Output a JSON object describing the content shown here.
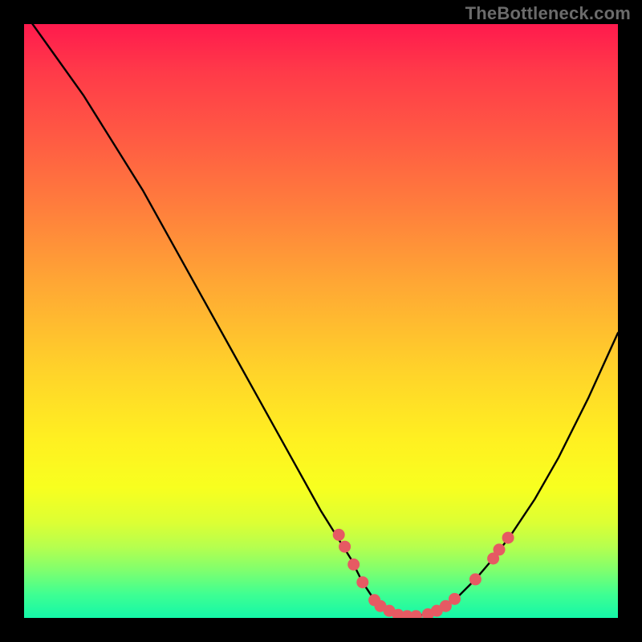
{
  "watermark": "TheBottleneck.com",
  "chart_data": {
    "type": "line",
    "title": "",
    "xlabel": "",
    "ylabel": "",
    "xlim": [
      0,
      100
    ],
    "ylim": [
      0,
      100
    ],
    "grid": false,
    "legend": false,
    "series": [
      {
        "name": "bottleneck-curve",
        "x": [
          0,
          5,
          10,
          15,
          20,
          25,
          30,
          35,
          40,
          45,
          50,
          55,
          57,
          59,
          61,
          63,
          65,
          67,
          70,
          73,
          76,
          79,
          82,
          86,
          90,
          95,
          100
        ],
        "y": [
          102,
          95,
          88,
          80,
          72,
          63,
          54,
          45,
          36,
          27,
          18,
          10,
          6,
          3,
          1,
          0.3,
          0.2,
          0.5,
          1.5,
          3.5,
          6.5,
          10,
          14,
          20,
          27,
          37,
          48
        ],
        "color": "#000000"
      }
    ],
    "markers": {
      "name": "highlight-dots",
      "color": "#e65a63",
      "points": [
        {
          "x": 53,
          "y": 14
        },
        {
          "x": 54,
          "y": 12
        },
        {
          "x": 55.5,
          "y": 9
        },
        {
          "x": 57,
          "y": 6
        },
        {
          "x": 59,
          "y": 3
        },
        {
          "x": 60,
          "y": 2
        },
        {
          "x": 61.5,
          "y": 1.2
        },
        {
          "x": 63,
          "y": 0.5
        },
        {
          "x": 64.5,
          "y": 0.3
        },
        {
          "x": 66,
          "y": 0.3
        },
        {
          "x": 68,
          "y": 0.6
        },
        {
          "x": 69.5,
          "y": 1.2
        },
        {
          "x": 71,
          "y": 2
        },
        {
          "x": 72.5,
          "y": 3.2
        },
        {
          "x": 76,
          "y": 6.5
        },
        {
          "x": 79,
          "y": 10
        },
        {
          "x": 80,
          "y": 11.5
        },
        {
          "x": 81.5,
          "y": 13.5
        }
      ]
    }
  }
}
